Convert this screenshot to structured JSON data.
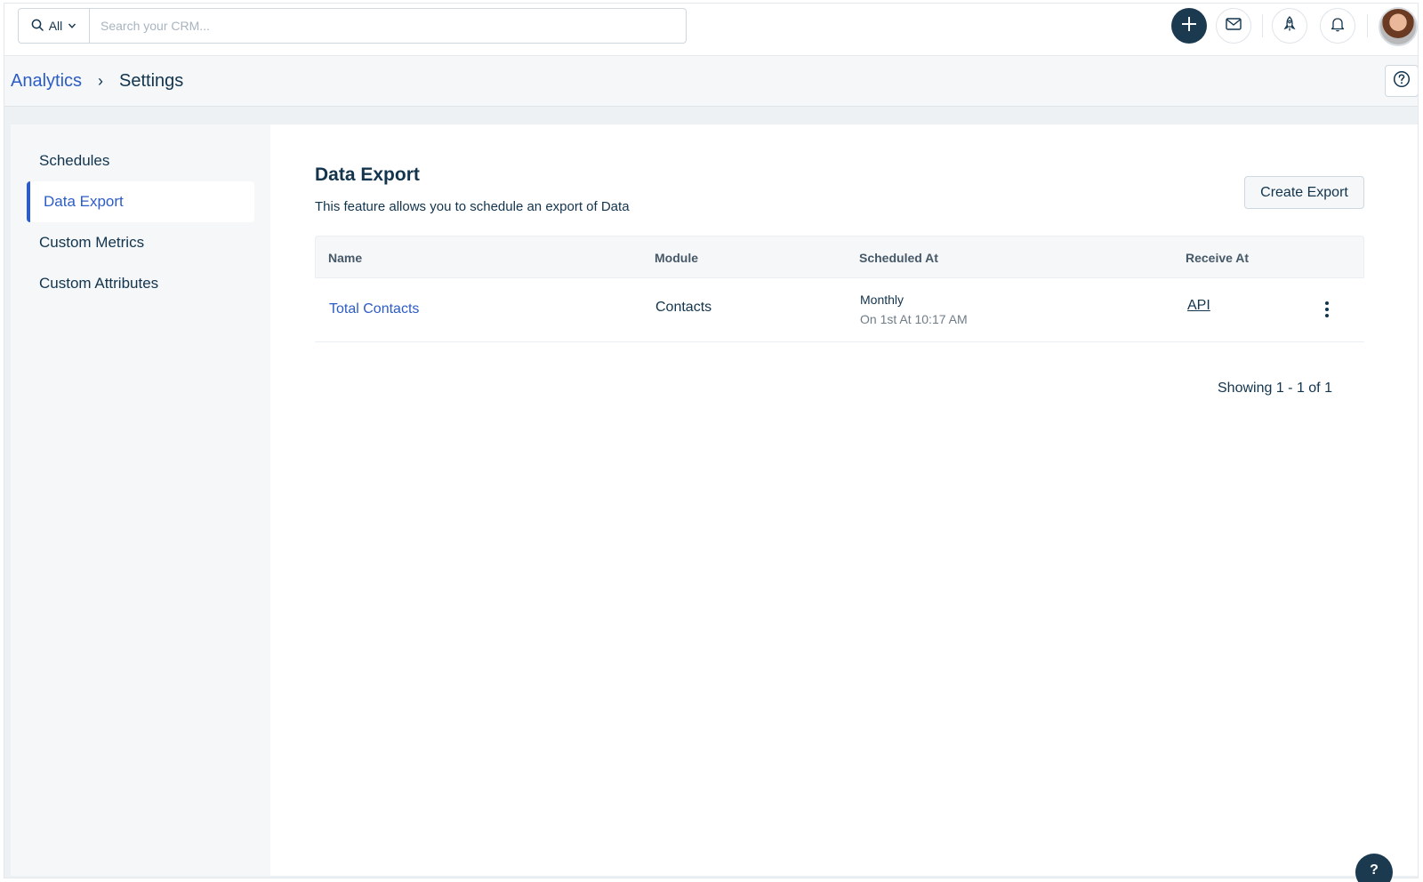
{
  "topbar": {
    "scope_label": "All",
    "search_placeholder": "Search your CRM...",
    "icons": [
      "search-icon",
      "chevron-down-icon",
      "plus-icon",
      "mail-icon",
      "rocket-icon",
      "bell-icon",
      "avatar"
    ],
    "accent_color": "#1b3a50"
  },
  "breadcrumb": {
    "parent": "Analytics",
    "separator": "›",
    "current": "Settings"
  },
  "sidebar": {
    "items": [
      {
        "label": "Schedules",
        "active": false
      },
      {
        "label": "Data Export",
        "active": true
      },
      {
        "label": "Custom Metrics",
        "active": false
      },
      {
        "label": "Custom Attributes",
        "active": false
      }
    ],
    "active_color": "#2c5cc5"
  },
  "main": {
    "title": "Data Export",
    "subtitle": "This feature allows you to schedule an export of Data",
    "create_button": "Create Export",
    "table": {
      "headers": [
        "Name",
        "Module",
        "Scheduled At",
        "Receive At"
      ],
      "rows": [
        {
          "name": "Total Contacts",
          "module": "Contacts",
          "schedule": "Monthly",
          "schedule_detail": "On 1st At 10:17 AM",
          "receive_at": "API"
        }
      ]
    },
    "pagination": "Showing 1 - 1 of 1"
  },
  "help_fab": "?"
}
